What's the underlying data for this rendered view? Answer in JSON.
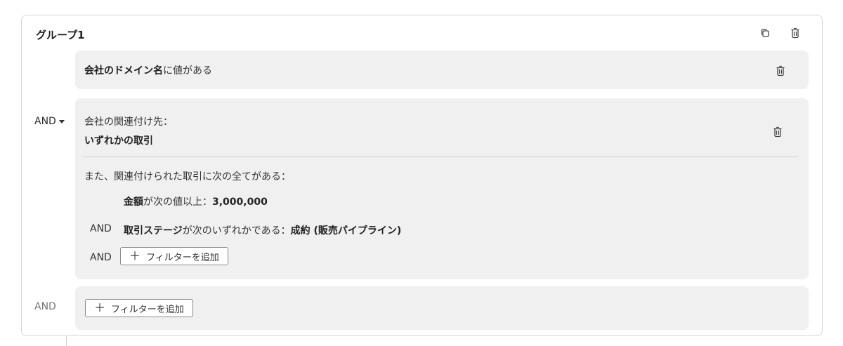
{
  "group": {
    "title": "グループ1",
    "copy_icon": "copy-icon",
    "delete_icon": "trash-icon"
  },
  "filter1": {
    "bold_text": "会社のドメイン名",
    "rest_text": "に値がある"
  },
  "and_operator": {
    "label": "AND"
  },
  "filter2": {
    "assoc_label": "会社の関連付け先：",
    "assoc_value": "いずれかの取引",
    "criteria_intro": "また、関連付けられた取引に次の全てがある：",
    "criteria": [
      {
        "prefix": "",
        "bold": "金額",
        "middle": "が次の値以上：",
        "value": "3,000,000"
      },
      {
        "prefix": "AND",
        "bold": "取引ステージ",
        "middle": "が次のいずれかである：",
        "value": "成約 (販売パイプライン)"
      }
    ],
    "add_prefix": "AND",
    "add_filter_label": "フィルターを追加"
  },
  "bottom": {
    "and_label": "AND",
    "add_filter_label": "フィルターを追加"
  },
  "icons": {
    "plus": "＋"
  }
}
